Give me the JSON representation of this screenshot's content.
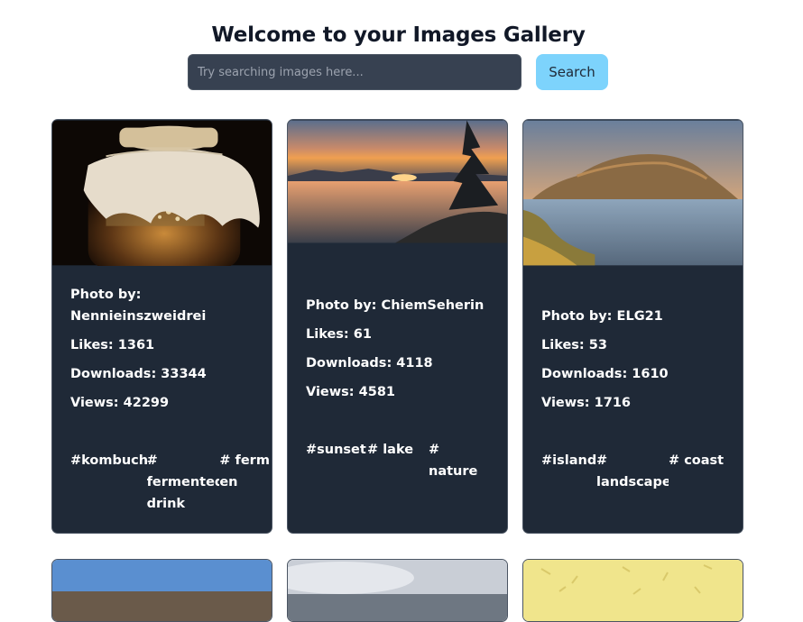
{
  "header": {
    "title": "Welcome to your Images Gallery"
  },
  "search": {
    "placeholder": "Try searching images here...",
    "button_label": "Search"
  },
  "cards": [
    {
      "photo_by": "Photo by:",
      "author": "Nennieinszweidrei",
      "likes": "Likes: 1361",
      "downloads": "Downloads: 33344",
      "views": "Views: 42299",
      "tags": [
        "#kombucha",
        "# fermented drink",
        "# fermen"
      ]
    },
    {
      "photo_by": "Photo by:",
      "author": "ChiemSeherin",
      "likes": "Likes: 61",
      "downloads": "Downloads: 4118",
      "views": "Views: 4581",
      "tags": [
        "#sunset",
        "# lake",
        "# nature"
      ]
    },
    {
      "photo_by": "Photo by:",
      "author": "ELG21",
      "likes": "Likes: 53",
      "downloads": "Downloads: 1610",
      "views": "Views: 1716",
      "tags": [
        "#island",
        "# landscape",
        "# coast"
      ]
    }
  ],
  "colors": {
    "card_bg": "#1f2937",
    "input_bg": "#374151",
    "button_bg": "#7dd3fc"
  }
}
